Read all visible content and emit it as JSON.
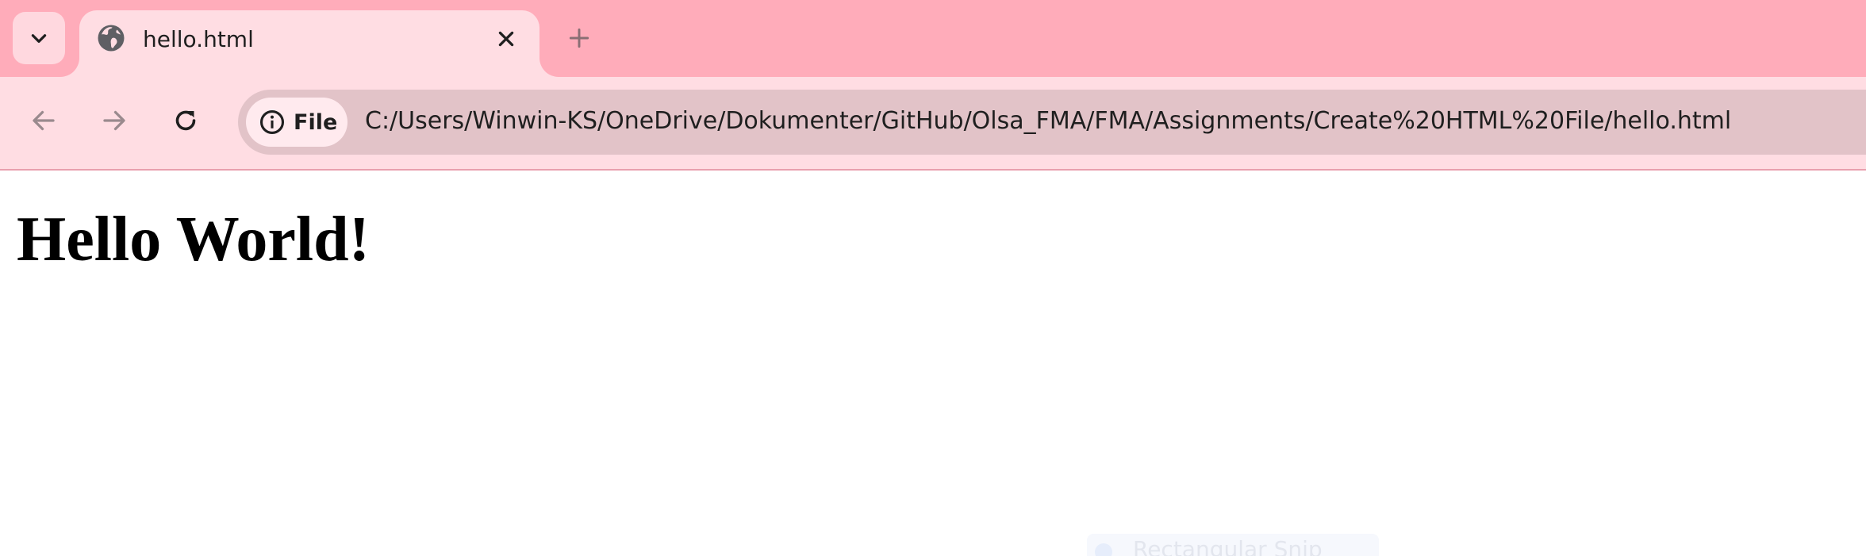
{
  "browser": {
    "tab": {
      "title": "hello.html",
      "favicon": "globe-icon",
      "close_icon": "close-icon"
    },
    "tab_search_icon": "chevron-down-icon",
    "new_tab_icon": "plus-icon",
    "toolbar": {
      "back_icon": "arrow-left-icon",
      "forward_icon": "arrow-right-icon",
      "reload_icon": "reload-icon",
      "site_info_icon": "info-icon",
      "site_chip_label": "File",
      "url": "C:/Users/Winwin-KS/OneDrive/Dokumenter/GitHub/Olsa_FMA/FMA/Assignments/Create%20HTML%20File/hello.html"
    },
    "colors": {
      "tabstrip": "#ffacba",
      "toolbar": "#ffdde3",
      "omnibox": "#e2c3c8",
      "icon_dark": "#1f1f1f",
      "icon_muted": "#9a8a8e"
    }
  },
  "page": {
    "heading": "Hello World!",
    "overlay_label": "Rectangular Snip"
  }
}
